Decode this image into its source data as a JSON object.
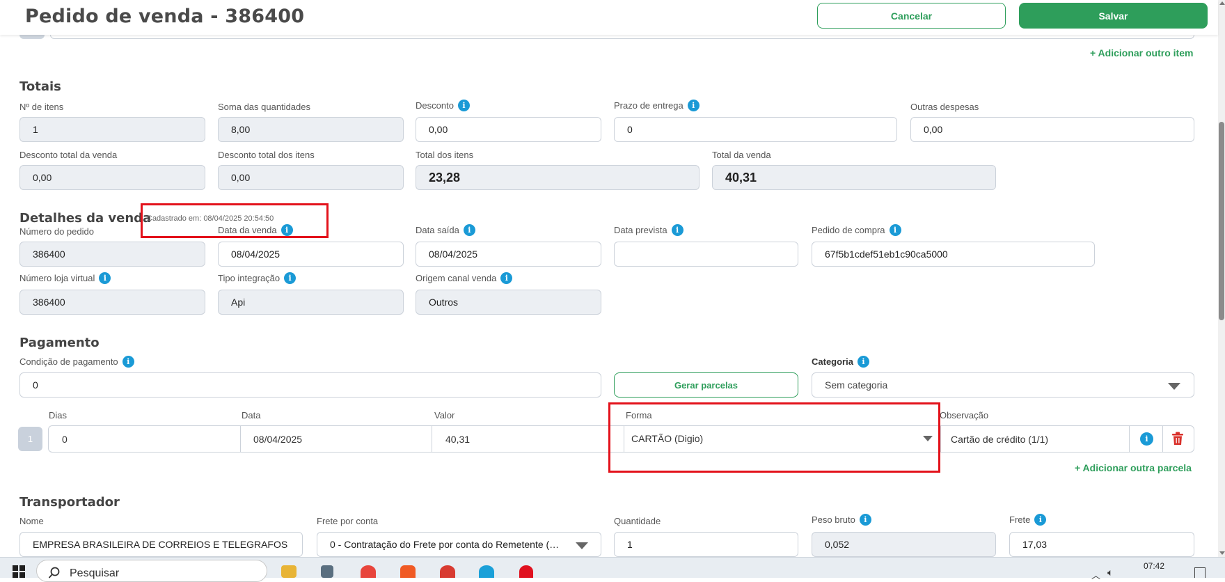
{
  "header": {
    "title": "Pedido de venda - 386400",
    "cancel_label": "Cancelar",
    "save_label": "Salvar"
  },
  "items": {
    "add_item_label": "+ Adicionar outro item"
  },
  "totais": {
    "title": "Totais",
    "n_itens": {
      "label": "Nº de itens",
      "value": "1"
    },
    "soma_qtd": {
      "label": "Soma das quantidades",
      "value": "8,00"
    },
    "desconto": {
      "label": "Desconto",
      "value": "0,00"
    },
    "prazo": {
      "label": "Prazo de entrega",
      "value": "0"
    },
    "outras": {
      "label": "Outras despesas",
      "value": "0,00"
    },
    "desc_total_venda": {
      "label": "Desconto total da venda",
      "value": "0,00"
    },
    "desc_total_itens": {
      "label": "Desconto total dos itens",
      "value": "0,00"
    },
    "total_itens": {
      "label": "Total dos itens",
      "value": "23,28"
    },
    "total_venda": {
      "label": "Total da venda",
      "value": "40,31"
    }
  },
  "detalhes": {
    "title": "Detalhes da venda",
    "cadastrado": "Cadastrado em: 08/04/2025 20:54:50",
    "numero_pedido": {
      "label": "Número do pedido",
      "value": "386400"
    },
    "data_venda": {
      "label": "Data da venda",
      "value": "08/04/2025"
    },
    "data_saida": {
      "label": "Data saída",
      "value": "08/04/2025"
    },
    "data_prevista": {
      "label": "Data prevista",
      "value": ""
    },
    "pedido_compra": {
      "label": "Pedido de compra",
      "value": "67f5b1cdef51eb1c90ca5000"
    },
    "numero_loja": {
      "label": "Número loja virtual",
      "value": "386400"
    },
    "tipo_integracao": {
      "label": "Tipo integração",
      "value": "Api"
    },
    "origem": {
      "label": "Origem canal venda",
      "value": "Outros"
    }
  },
  "pagamento": {
    "title": "Pagamento",
    "condicao": {
      "label": "Condição de pagamento",
      "value": "0"
    },
    "gerar_label": "Gerar parcelas",
    "categoria": {
      "label": "Categoria",
      "value": "Sem categoria"
    },
    "headers": {
      "dias": "Dias",
      "data": "Data",
      "valor": "Valor",
      "forma": "Forma",
      "obs": "Observação"
    },
    "parcela": {
      "index": "1",
      "dias": "0",
      "data": "08/04/2025",
      "valor": "40,31",
      "forma": "CARTÃO (Digio)",
      "obs": "Cartão de crédito (1/1)"
    },
    "add_parcela_label": "+ Adicionar outra parcela"
  },
  "transportador": {
    "title": "Transportador",
    "nome": {
      "label": "Nome",
      "value": "EMPRESA BRASILEIRA DE CORREIOS E TELEGRAFOS"
    },
    "frete_conta": {
      "label": "Frete por conta",
      "value": "0 - Contratação do Frete por conta do Remetente (…"
    },
    "quantidade": {
      "label": "Quantidade",
      "value": "1"
    },
    "peso": {
      "label": "Peso bruto",
      "value": "0,052"
    },
    "frete": {
      "label": "Frete",
      "value": "17,03"
    }
  },
  "taskbar": {
    "search_placeholder": "Pesquisar",
    "time": "07:42"
  },
  "colors": {
    "accent": "#2e9e5b",
    "info": "#1a9ad6",
    "highlight": "#e3121b",
    "delete": "#d9312b"
  }
}
